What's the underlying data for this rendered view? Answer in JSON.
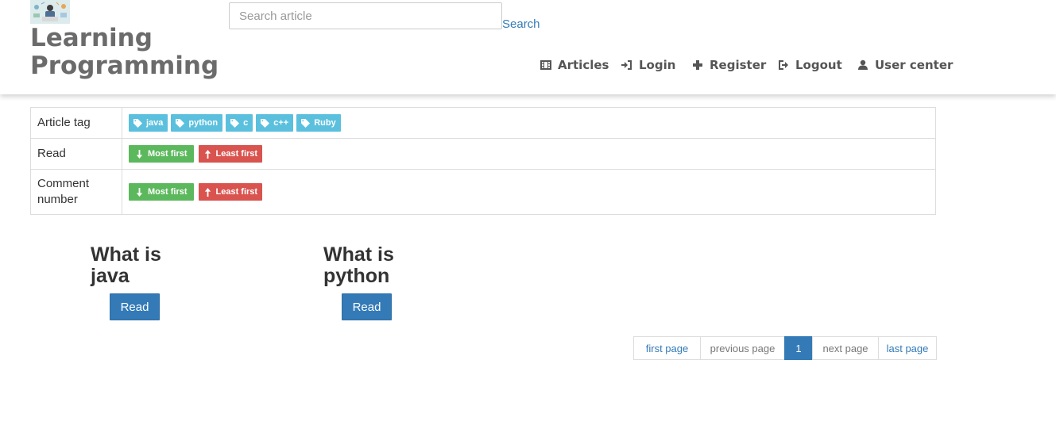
{
  "header": {
    "site_title": "Learning Programming",
    "search_placeholder": "Search article",
    "search_label": "Search"
  },
  "nav": {
    "items": [
      {
        "label": "Articles",
        "icon": "film-icon"
      },
      {
        "label": "Login",
        "icon": "login-icon"
      },
      {
        "label": "Register",
        "icon": "plus-icon"
      },
      {
        "label": "Logout",
        "icon": "logout-icon"
      },
      {
        "label": "User center",
        "icon": "user-icon"
      }
    ]
  },
  "filters": {
    "tag_label": "Article tag",
    "tags": [
      "java",
      "python",
      "c",
      "c++",
      "Ruby"
    ],
    "read_label": "Read",
    "comment_label": "Comment number",
    "most_first": "Most first",
    "least_first": "Least first"
  },
  "articles": [
    {
      "title": "What is java",
      "button": "Read"
    },
    {
      "title": "What is python",
      "button": "Read"
    }
  ],
  "pagination": {
    "first": "first page",
    "previous": "previous page",
    "current": "1",
    "next": "next page",
    "last": "last page"
  },
  "colors": {
    "primary": "#337ab7",
    "info": "#5bc0de",
    "success": "#5cb85c",
    "danger": "#d9534f"
  }
}
